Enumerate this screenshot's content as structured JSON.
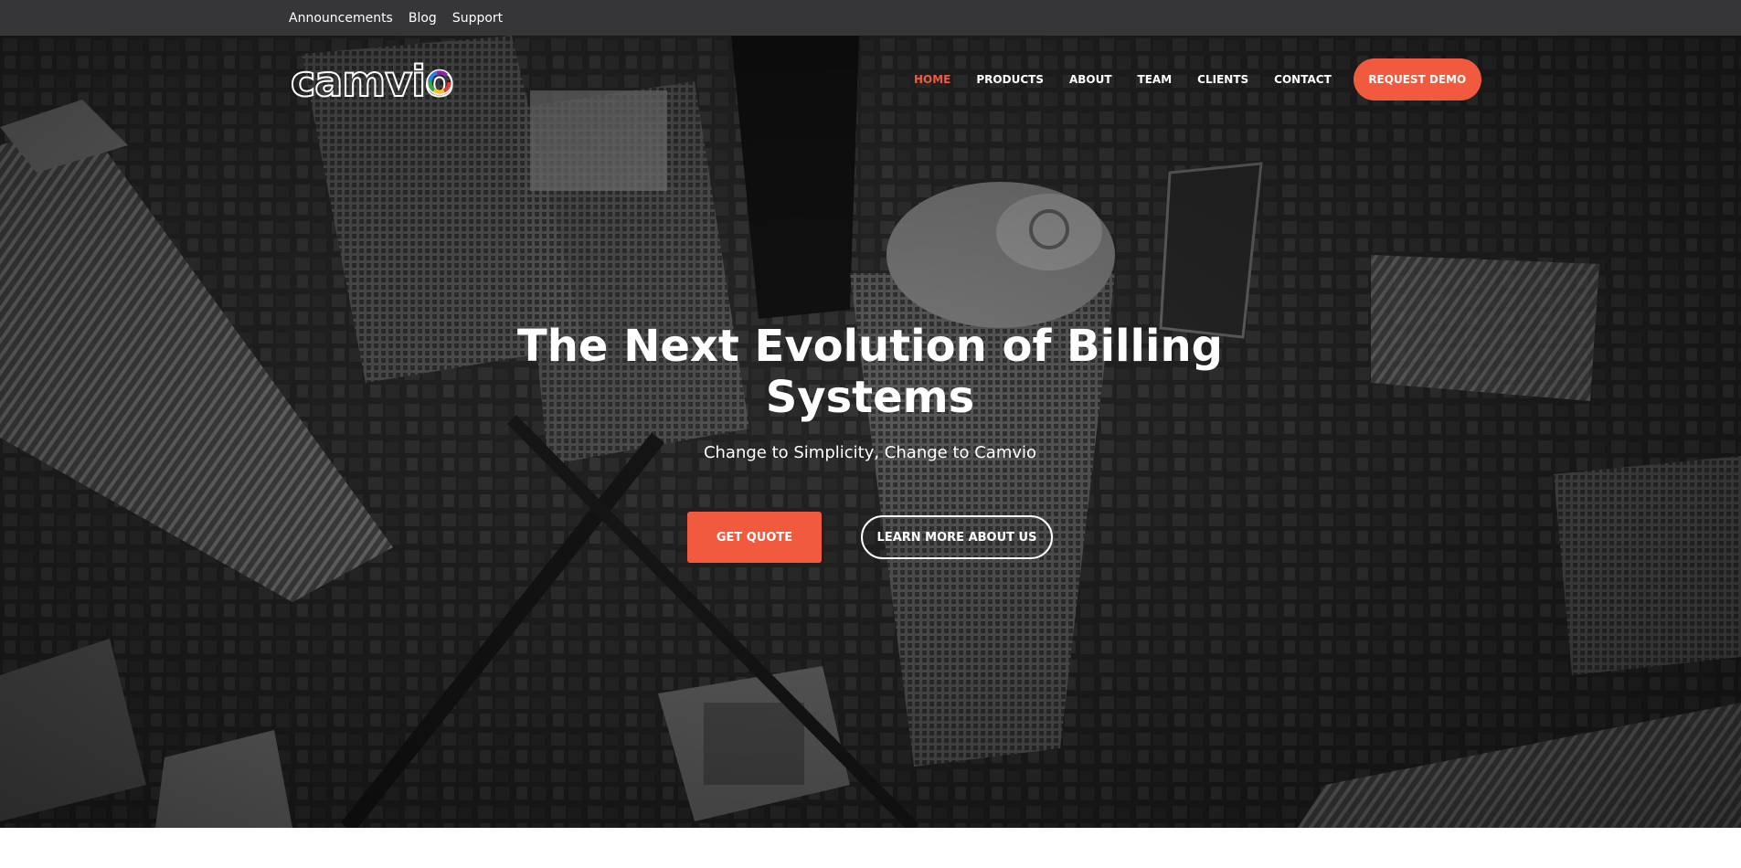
{
  "topbar": {
    "links": [
      "Announcements",
      "Blog",
      "Support"
    ]
  },
  "brand": {
    "logo_text": "camvio",
    "accent": "#f15a3f",
    "topbar_bg": "#363638"
  },
  "nav": {
    "items": [
      "HOME",
      "PRODUCTS",
      "ABOUT",
      "TEAM",
      "CLIENTS",
      "CONTACT"
    ],
    "active": "HOME",
    "cta": "REQUEST DEMO"
  },
  "hero": {
    "title": "The Next Evolution of Billing Systems",
    "subtitle": "Change to Simplicity, Change to Camvio",
    "primary_button": "GET QUOTE",
    "secondary_button": "LEARN MORE ABOUT US"
  }
}
